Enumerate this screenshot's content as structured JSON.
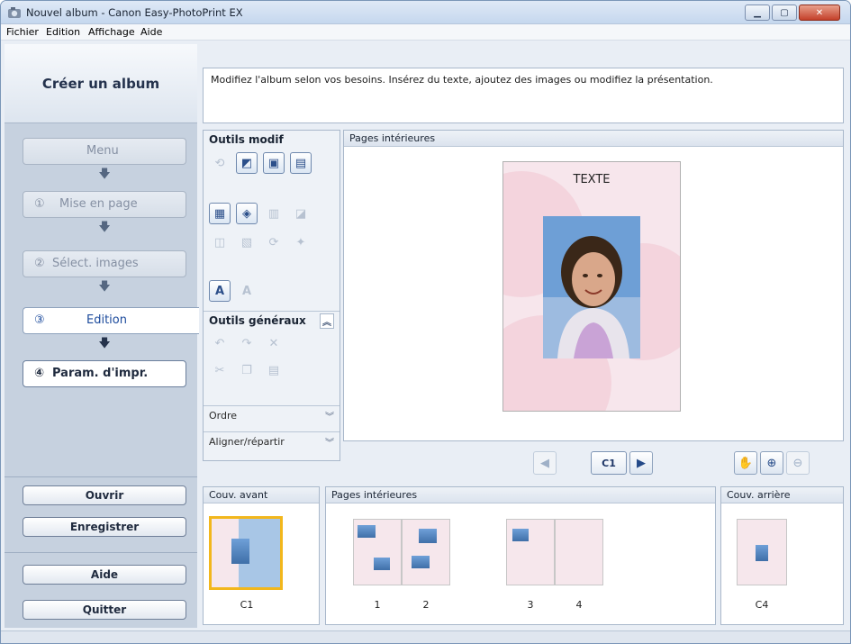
{
  "window": {
    "title": "Nouvel album - Canon Easy-PhotoPrint EX"
  },
  "menu": {
    "items": [
      "Fichier",
      "Edition",
      "Affichage",
      "Aide"
    ]
  },
  "sidebar": {
    "brand": "Créer un album",
    "steps": [
      {
        "num": "",
        "label": "Menu"
      },
      {
        "num": "①",
        "label": "Mise en page"
      },
      {
        "num": "②",
        "label": "Sélect. images"
      },
      {
        "num": "③",
        "label": "Edition"
      },
      {
        "num": "④",
        "label": "Param. d'impr."
      }
    ],
    "buttons": {
      "open": "Ouvrir",
      "save": "Enregistrer",
      "help": "Aide",
      "quit": "Quitter"
    }
  },
  "message": "Modifiez l'album selon vos besoins. Insérez du texte, ajoutez des images ou modifiez la présentation.",
  "tools": {
    "edit_header": "Outils modif",
    "general_header": "Outils généraux",
    "order": "Ordre",
    "align": "Aligner/répartir"
  },
  "canvas": {
    "header": "Pages intérieures",
    "page_text": "TEXTE"
  },
  "navigation": {
    "current_page": "C1"
  },
  "strips": {
    "front": {
      "header": "Couv. avant",
      "pages": [
        "C1"
      ]
    },
    "inner": {
      "header": "Pages intérieures",
      "pages": [
        "1",
        "2",
        "3",
        "4"
      ]
    },
    "back": {
      "header": "Couv. arrière",
      "pages": [
        "C4"
      ]
    }
  },
  "colors": {
    "accent": "#1b4a9c",
    "selection": "#f2b71c",
    "page_bg": "#f7e6ec"
  }
}
